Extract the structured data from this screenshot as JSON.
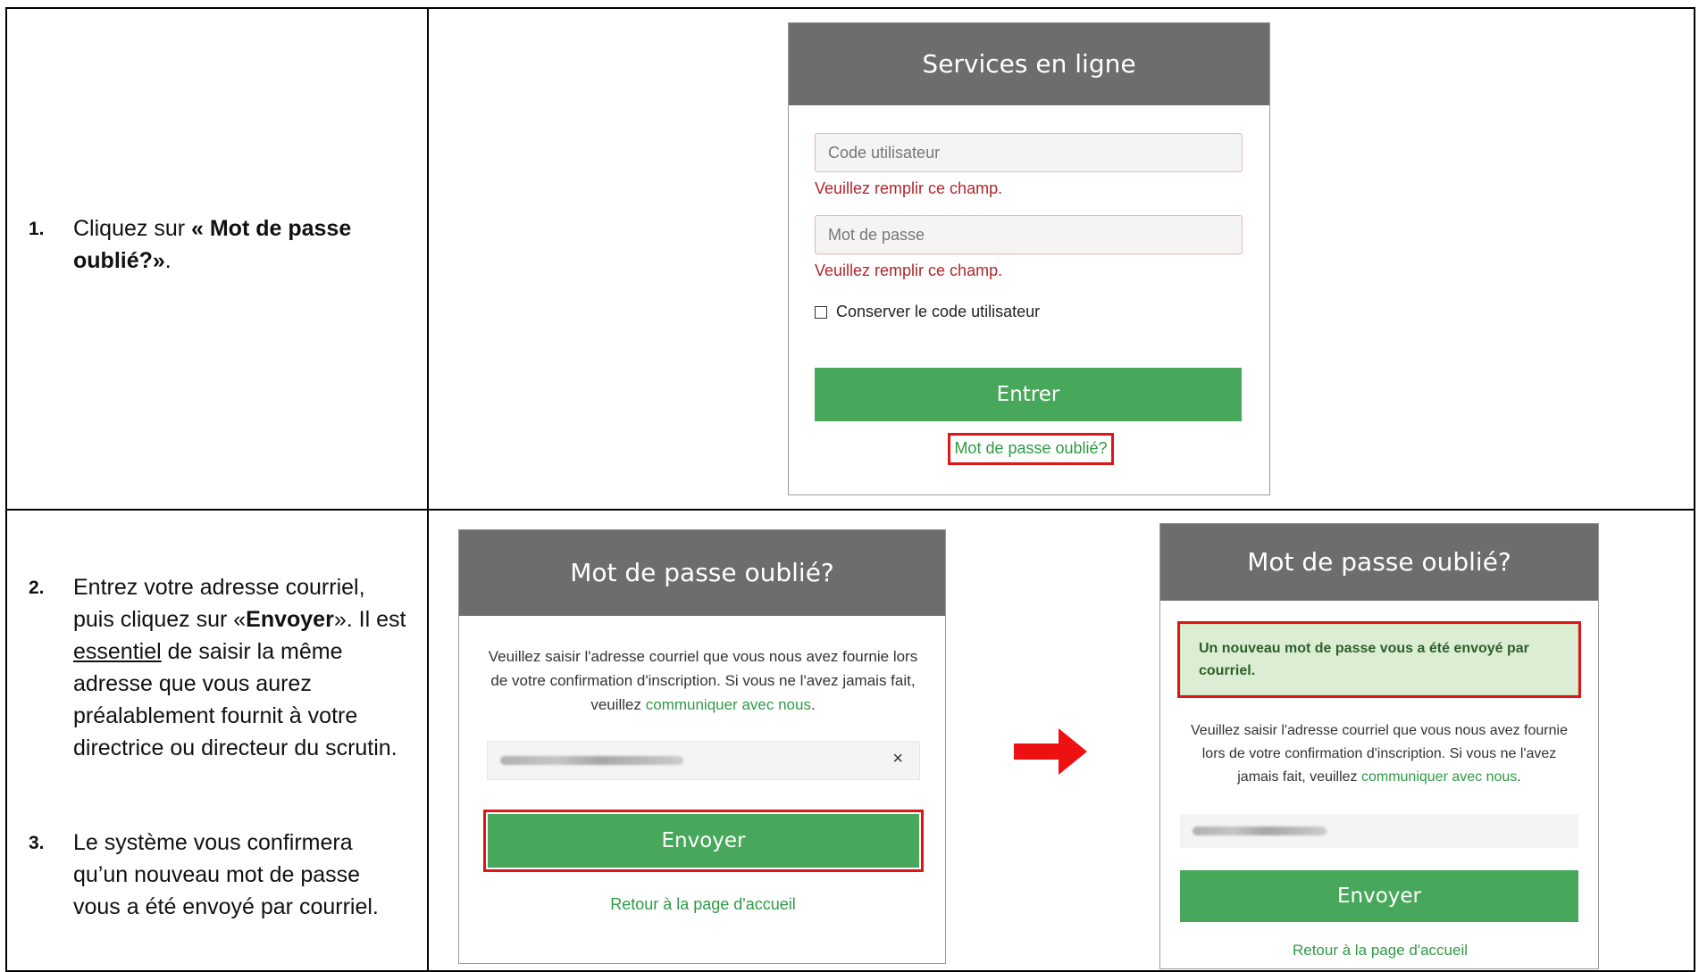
{
  "steps": {
    "step1": {
      "num": "1.",
      "pre": "Cliquez sur ",
      "bold": "« Mot de passe oublié?»",
      "post": "."
    },
    "step2": {
      "num": "2.",
      "pre": "Entrez votre adresse courriel, puis cliquez sur «",
      "bold": "Envoyer",
      "mid": "».  Il est ",
      "underline": "essentiel",
      "post": " de saisir la même adresse que vous aurez préalablement fournit à votre directrice ou directeur du scrutin."
    },
    "step3": {
      "num": "3.",
      "text": "Le système vous confirmera qu’un nouveau mot de passe vous a été envoyé par courriel."
    }
  },
  "login_panel": {
    "title": "Services en ligne",
    "user_placeholder": "Code utilisateur",
    "user_error": "Veuillez remplir ce champ.",
    "password_placeholder": "Mot de passe",
    "password_error": "Veuillez remplir ce champ.",
    "remember_label": "Conserver le code utilisateur",
    "submit_label": "Entrer",
    "forgot_link": "Mot de passe oublié?"
  },
  "forgot_panel": {
    "title": "Mot de passe oublié?",
    "intro_text": "Veuillez saisir l'adresse courriel que vous nous avez fournie lors de votre confirmation d'inscription. Si vous ne l'avez jamais fait, veuillez ",
    "intro_link": "communiquer avec nous",
    "intro_end": ".",
    "clear_symbol": "×",
    "submit_label": "Envoyer",
    "back_link": "Retour à la page d'accueil"
  },
  "confirm_panel": {
    "title": "Mot de passe oublié?",
    "success_message": "Un nouveau mot de passe vous a été envoyé par courriel.",
    "intro_text": "Veuillez saisir l'adresse courriel que vous nous avez fournie lors de votre confirmation d'inscription. Si vous ne l'avez jamais fait, veuillez ",
    "intro_link": "communiquer avec nous",
    "intro_end": ".",
    "submit_label": "Envoyer",
    "back_link": "Retour à la page d'accueil"
  },
  "icons": {
    "arrow": "right-arrow-icon",
    "clear": "clear-icon",
    "checkbox": "checkbox-icon"
  },
  "colors": {
    "header_gray": "#6d6d6d",
    "button_green": "#47a85b",
    "link_green": "#2f9a46",
    "error_red": "#b3262a",
    "highlight_red": "#e01515",
    "success_bg": "#dbeed4"
  }
}
